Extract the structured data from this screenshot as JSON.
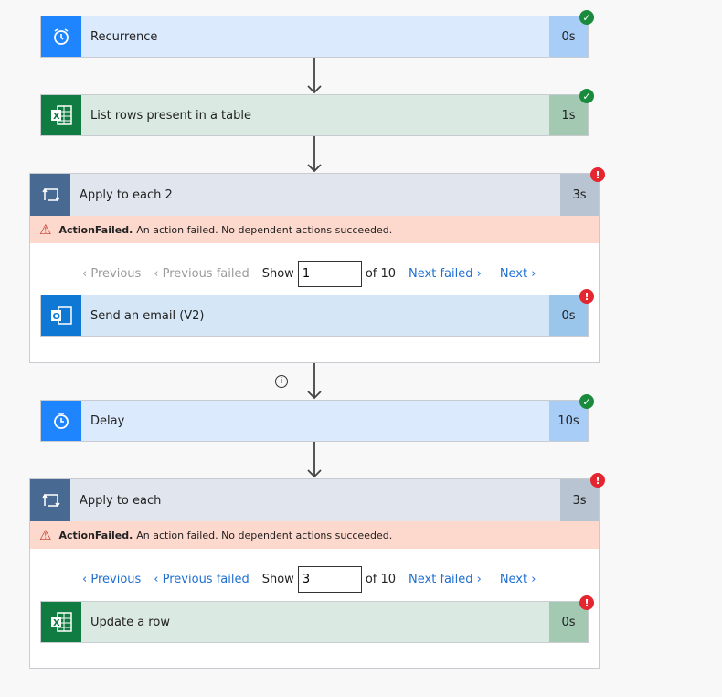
{
  "steps": {
    "recurrence": {
      "title": "Recurrence",
      "duration": "0s",
      "status": "succeeded",
      "icon": "alarm-clock-icon"
    },
    "list_rows": {
      "title": "List rows present in a table",
      "duration": "1s",
      "status": "succeeded",
      "icon": "excel-icon"
    },
    "apply2": {
      "title": "Apply to each 2",
      "duration": "3s",
      "status": "failed",
      "icon": "loop-icon",
      "error_code": "ActionFailed.",
      "error_message": "An action failed. No dependent actions succeeded.",
      "pager": {
        "previous": "Previous",
        "previous_failed": "Previous failed",
        "show": "Show",
        "value": "1",
        "of": "of 10",
        "next_failed": "Next failed",
        "next": "Next"
      },
      "inner": {
        "title": "Send an email (V2)",
        "duration": "0s",
        "status": "failed",
        "icon": "outlook-icon"
      }
    },
    "delay": {
      "title": "Delay",
      "duration": "10s",
      "status": "succeeded",
      "icon": "timer-icon"
    },
    "apply1": {
      "title": "Apply to each",
      "duration": "3s",
      "status": "failed",
      "icon": "loop-icon",
      "error_code": "ActionFailed.",
      "error_message": "An action failed. No dependent actions succeeded.",
      "pager": {
        "previous": "Previous",
        "previous_failed": "Previous failed",
        "show": "Show",
        "value": "3",
        "of": "of 10",
        "next_failed": "Next failed",
        "next": "Next"
      },
      "inner": {
        "title": "Update a row",
        "duration": "0s",
        "status": "failed",
        "icon": "excel-icon"
      }
    }
  },
  "colors": {
    "success": "#1a8a3c",
    "error": "#e3262f",
    "link": "#1f6fd1",
    "banner": "#fdd8cc"
  }
}
